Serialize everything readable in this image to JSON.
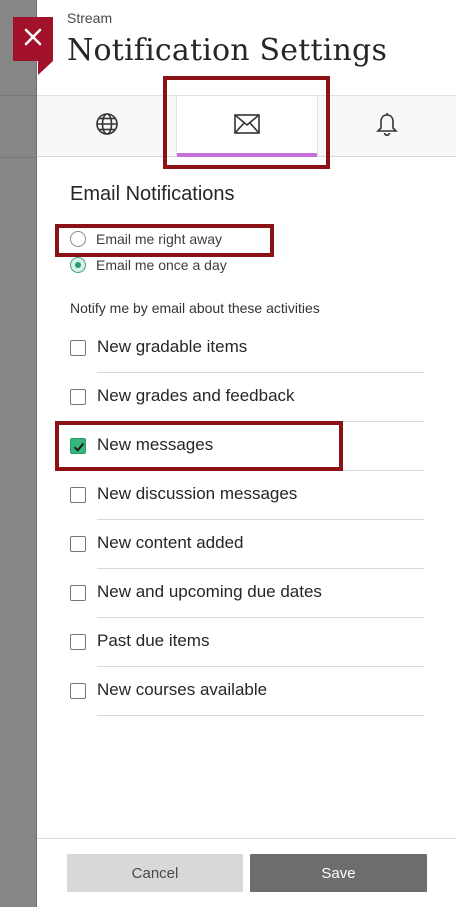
{
  "header": {
    "eyebrow": "Stream",
    "title": "Notification Settings"
  },
  "tabs": [
    {
      "icon": "globe-icon",
      "active": false
    },
    {
      "icon": "envelope-icon",
      "active": true
    },
    {
      "icon": "bell-icon",
      "active": false
    }
  ],
  "email": {
    "heading": "Email Notifications",
    "frequency_options": [
      {
        "label": "Email me right away",
        "selected": false
      },
      {
        "label": "Email me once a day",
        "selected": true
      }
    ],
    "activities_heading": "Notify me by email about these activities",
    "activities": [
      {
        "label": "New gradable items",
        "checked": false
      },
      {
        "label": "New grades and feedback",
        "checked": false
      },
      {
        "label": "New messages",
        "checked": true
      },
      {
        "label": "New discussion messages",
        "checked": false
      },
      {
        "label": "New content added",
        "checked": false
      },
      {
        "label": "New and upcoming due dates",
        "checked": false
      },
      {
        "label": "Past due items",
        "checked": false
      },
      {
        "label": "New courses available",
        "checked": false
      }
    ]
  },
  "footer": {
    "cancel_label": "Cancel",
    "save_label": "Save"
  },
  "colors": {
    "close_tab": "#a3122b",
    "tab_underline": "#c472d9",
    "highlight_box": "#8d1216",
    "checkbox_checked": "#35b57a",
    "save_button": "#6d6d6d",
    "cancel_button": "#d8d8d8"
  }
}
